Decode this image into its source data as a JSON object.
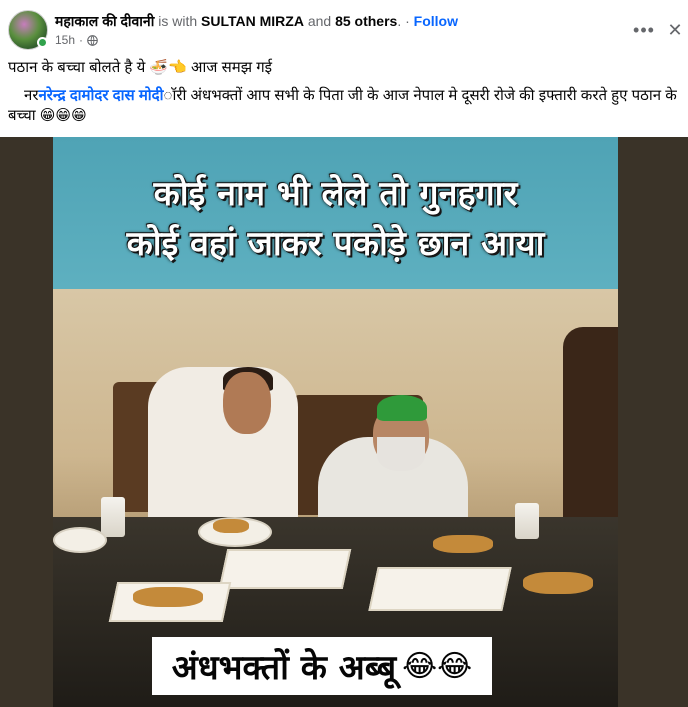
{
  "post": {
    "author": "महाकाल की दीवानी",
    "with_text": " is with ",
    "tagged": "SULTAN MIRZA",
    "and_text": " and ",
    "others": "85 others",
    "period": ".",
    "dot": " · ",
    "follow_label": "Follow",
    "time": "15h",
    "sep": "·",
    "more_icon": "more-options-icon",
    "close_icon": "close-icon",
    "more_glyph": "•••",
    "close_glyph": "✕"
  },
  "text": {
    "line1": "पठान के बच्चा बोलते है ये 🍜👈 आज समझ गई",
    "line2_prefix": "नर",
    "line2_link": "नरेन्द्र दामोदर दास मोदी",
    "line2_suffix": "ॉरी  अंधभक्तों आप सभी के पिता जी के आज नेपाल मे दूसरी रोजे की इफ्तारी करते हुए पठान के बच्चा 😁😁😁"
  },
  "image": {
    "caption_top_1": "कोई नाम भी लेले तो गुनहगार",
    "caption_top_2": "कोई वहां जाकर पकोड़े छान आया",
    "caption_bottom": "अंधभक्तों के अब्बू",
    "caption_bottom_emoji": "😂😂"
  },
  "colors": {
    "link": "#0866ff",
    "muted": "#65676b",
    "banner": "#56a9ba"
  }
}
